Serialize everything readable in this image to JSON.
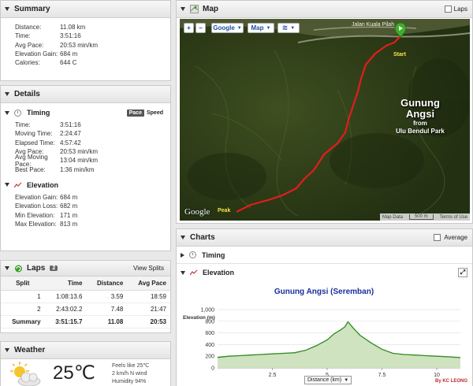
{
  "summary": {
    "title": "Summary",
    "rows": [
      {
        "label": "Distance:",
        "value": "11.08 km"
      },
      {
        "label": "Time:",
        "value": "3:51:16"
      },
      {
        "label": "Avg Pace:",
        "value": "20:53 min/km"
      },
      {
        "label": "Elevation Gain:",
        "value": "684 m"
      },
      {
        "label": "Calories:",
        "value": "644 C"
      }
    ]
  },
  "details": {
    "title": "Details",
    "timing": {
      "title": "Timing",
      "toggle_pace": "Pace",
      "toggle_speed": "Speed",
      "rows": [
        {
          "label": "Time:",
          "value": "3:51:16"
        },
        {
          "label": "Moving Time:",
          "value": "2:24:47"
        },
        {
          "label": "Elapsed Time:",
          "value": "4:57:42"
        },
        {
          "label": "Avg Pace:",
          "value": "20:53 min/km"
        },
        {
          "label": "Avg Moving Pace:",
          "value": "13:04 min/km"
        },
        {
          "label": "Best Pace:",
          "value": "1:36 min/km"
        }
      ]
    },
    "elevation": {
      "title": "Elevation",
      "rows": [
        {
          "label": "Elevation Gain:",
          "value": "684 m"
        },
        {
          "label": "Elevation Loss:",
          "value": "682 m"
        },
        {
          "label": "Min Elevation:",
          "value": "171 m"
        },
        {
          "label": "Max Elevation:",
          "value": "813 m"
        }
      ]
    }
  },
  "laps": {
    "title": "Laps",
    "count": "2",
    "view_splits": "View Splits",
    "headers": [
      "Split",
      "Time",
      "Distance",
      "Avg Pace"
    ],
    "rows": [
      [
        "1",
        "1:08:13.6",
        "3.59",
        "18:59"
      ],
      [
        "2",
        "2:43:02.2",
        "7.48",
        "21:47"
      ]
    ],
    "summary": [
      "Summary",
      "3:51:15.7",
      "11.08",
      "20:53"
    ]
  },
  "weather": {
    "title": "Weather",
    "temp": "25℃",
    "feels_like": "Feels like 25℃",
    "wind": "2 km/h N wind",
    "humidity": "Humidity 94%"
  },
  "map": {
    "title": "Map",
    "laps_label": "Laps",
    "zoom_in": "+",
    "zoom_out": "−",
    "provider_btn": "Google",
    "type_btn": "Map",
    "road_label": "Jalan Kuala Pilah",
    "start_label": "Start",
    "peak_label": "Peak",
    "overlay_line1": "Gunung",
    "overlay_line2": "Angsi",
    "overlay_line3": "from",
    "overlay_line4": "Ulu Bendul Park",
    "google_logo": "Google",
    "attr_data": "Map Data",
    "attr_scale": "500 m",
    "attr_terms": "Terms of Use"
  },
  "charts": {
    "title": "Charts",
    "average_label": "Average",
    "timing_label": "Timing",
    "elevation_label": "Elevation",
    "credit": "By KC LEONG",
    "xaxis_select": "Distance (km)"
  },
  "chart_data": {
    "type": "area",
    "title": "Gunung Angsi (Seremban)",
    "ylabel": "Elevation (m)",
    "xlabel": "Distance (km)",
    "xlim": [
      0,
      11.08
    ],
    "ylim": [
      0,
      1000
    ],
    "yticks": [
      0,
      200,
      400,
      600,
      800,
      1000
    ],
    "ytick_labels": [
      "0",
      "200",
      "400",
      "600",
      "800",
      "1,000"
    ],
    "xticks": [
      2.5,
      5,
      7.5,
      10
    ],
    "xtick_labels": [
      "2.5",
      "5",
      "7.5",
      "10"
    ],
    "grid": true,
    "x": [
      0,
      0.5,
      1,
      1.5,
      2,
      2.5,
      3,
      3.5,
      4,
      4.5,
      5,
      5.3,
      5.6,
      5.8,
      5.95,
      6.2,
      6.5,
      7,
      7.5,
      8,
      8.5,
      9,
      9.5,
      10,
      10.5,
      11.08
    ],
    "y": [
      180,
      200,
      210,
      220,
      230,
      240,
      250,
      260,
      300,
      380,
      480,
      580,
      650,
      700,
      790,
      680,
      560,
      430,
      320,
      250,
      230,
      220,
      210,
      200,
      190,
      175
    ],
    "colors": {
      "line": "#2f8a1e",
      "fill": "#cfe3c0",
      "title": "#1a2f9c"
    }
  }
}
